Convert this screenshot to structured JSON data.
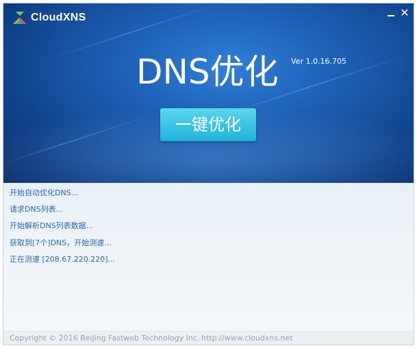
{
  "app": {
    "logo_text": "CloudXNS",
    "title": "DNS优化",
    "version": "Ver 1.0.16.705",
    "optimize_button": "一键优化",
    "minimize_glyph": "—",
    "close_glyph": "✕"
  },
  "log": [
    "开始自动优化DNS...",
    "请求DNS列表...",
    "开始解析DNS列表数据...",
    "获取到[7个]DNS，开始测速...",
    "正在测速 [208.67.220.220]..."
  ],
  "footer": {
    "copyright": "Copyright © 2016 Beijing Fastweb Technology Inc.",
    "url": "http://www.cloudxns.net"
  },
  "colors": {
    "header": "#1d5fb5",
    "button": "#2bbfe0",
    "log_text": "#2d67ae"
  }
}
